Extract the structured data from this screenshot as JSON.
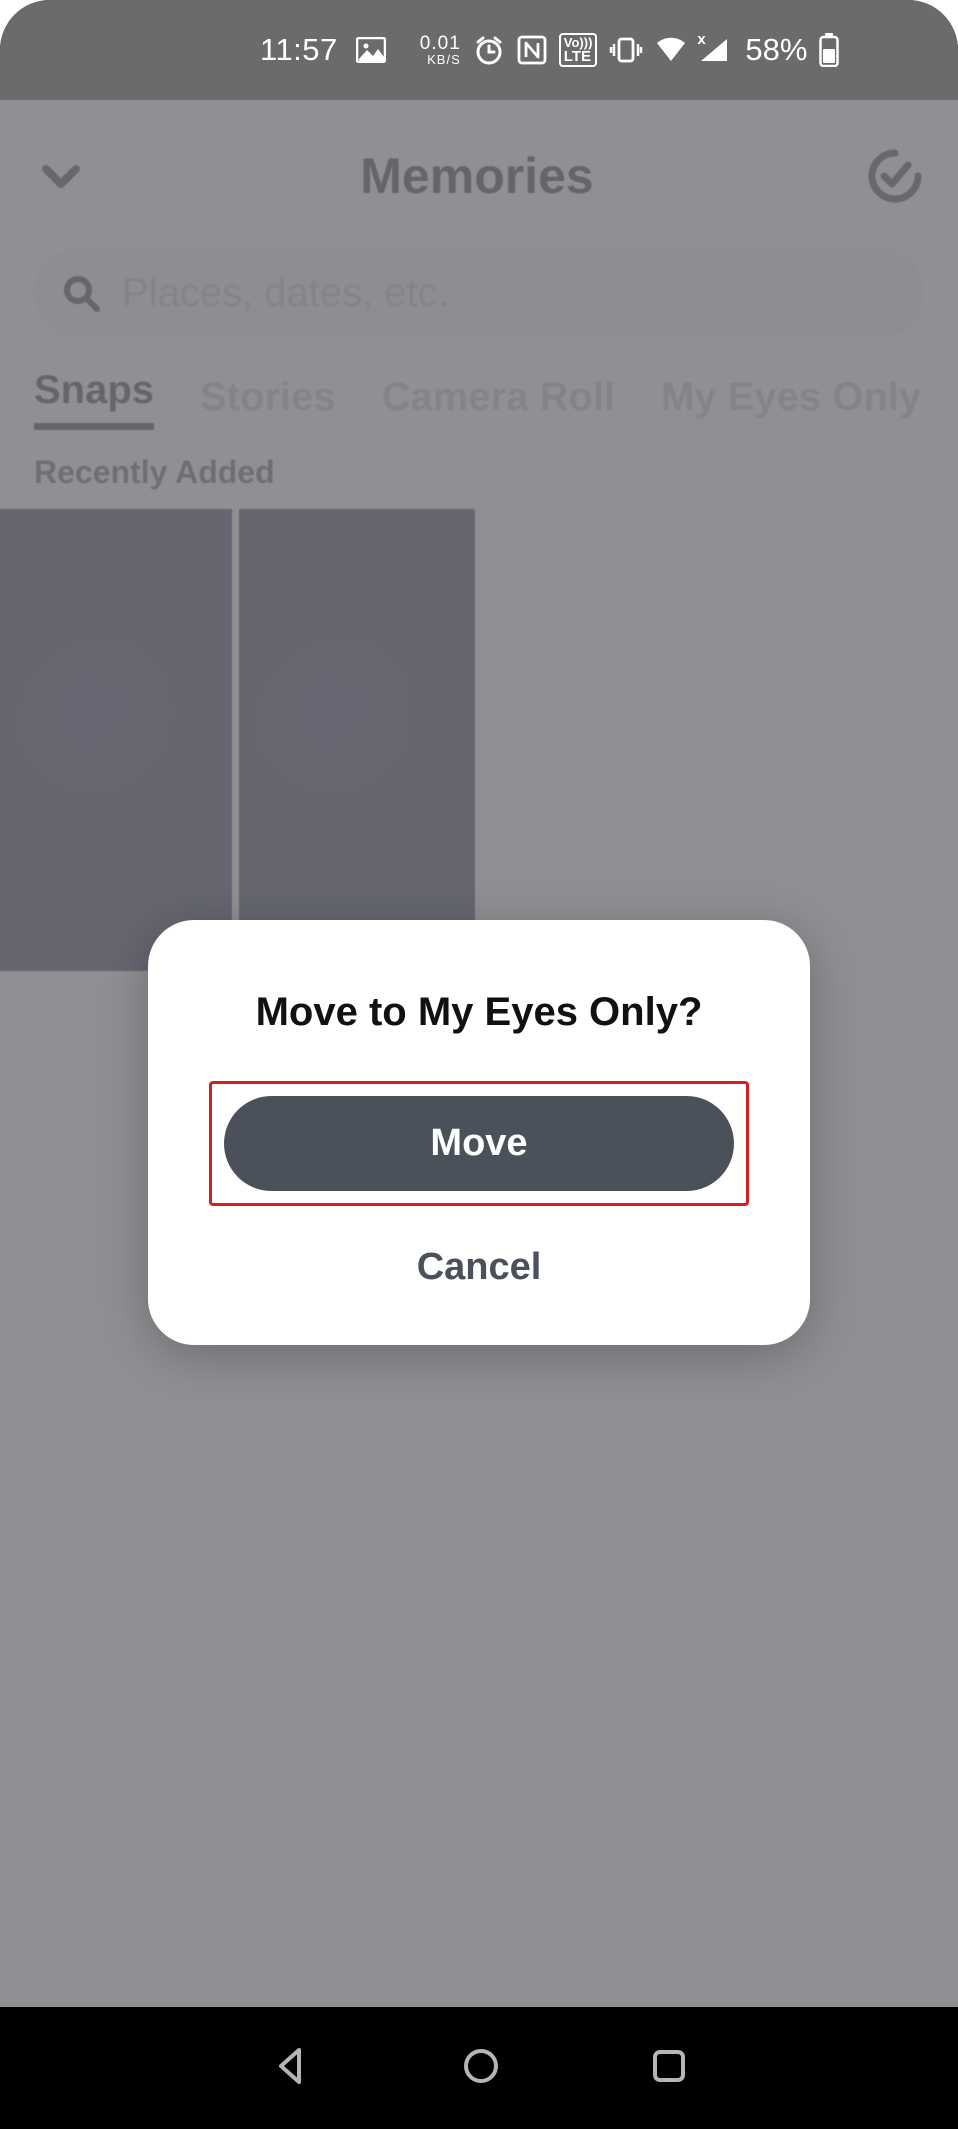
{
  "status": {
    "time": "11:57",
    "speed_value": "0.01",
    "speed_unit": "KB/S",
    "lte_top": "Vo)))",
    "lte_bot": "LTE",
    "battery_pct": "58%"
  },
  "header": {
    "title": "Memories"
  },
  "search": {
    "placeholder": "Places, dates, etc."
  },
  "tabs": {
    "items": [
      {
        "label": "Snaps",
        "active": true
      },
      {
        "label": "Stories",
        "active": false
      },
      {
        "label": "Camera Roll",
        "active": false
      },
      {
        "label": "My Eyes Only",
        "active": false
      }
    ]
  },
  "section": {
    "recently_added_label": "Recently Added"
  },
  "modal": {
    "title": "Move to My Eyes Only?",
    "move_label": "Move",
    "cancel_label": "Cancel"
  }
}
